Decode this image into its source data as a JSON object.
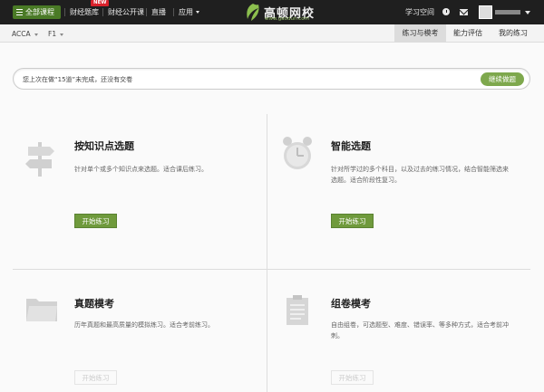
{
  "topbar": {
    "all_courses": "全部课程",
    "nav": [
      "财经题库",
      "财经公开课",
      "直播",
      "应用"
    ],
    "new_badge": "NEW",
    "logo_name": "高顿网校",
    "logo_url": "www.gaodun.com",
    "study_space": "学习空间"
  },
  "subbar": {
    "subject": "ACCA",
    "level": "F1",
    "tabs": [
      "练习与模考",
      "能力评估",
      "我的练习"
    ]
  },
  "notice": {
    "text": "您上次在做“15道”未完成，还没有交卷",
    "button": "继续做题"
  },
  "cards": [
    {
      "title": "按知识点选题",
      "desc": "针对单个或多个知识点来选题。适合课后练习。",
      "button": "开始练习"
    },
    {
      "title": "智能选题",
      "desc": "针对所学过的多个科目，以及过去的练习情况，结合智能筛选来选题。适合阶段性复习。",
      "button": "开始练习"
    },
    {
      "title": "真题模考",
      "desc": "历年真题和最高质量的模拟练习。适合考前练习。",
      "button": "开始练习"
    },
    {
      "title": "组卷模考",
      "desc": "自由组卷，可选题型、难度、错误率、等多种方式，适合考前冲刺。",
      "button": "开始练习"
    }
  ],
  "colors": {
    "accent": "#6f9a3c",
    "topbar": "#1f1f1f",
    "new": "#d8212a"
  }
}
